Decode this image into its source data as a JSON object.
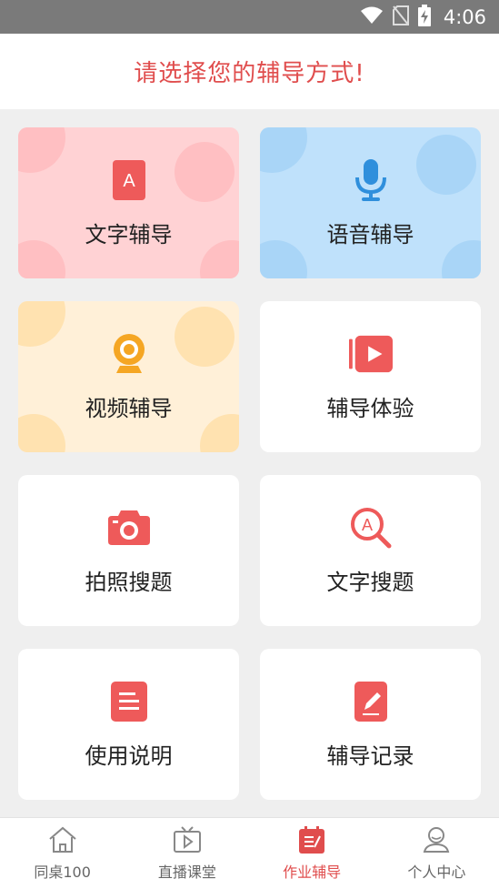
{
  "status_bar": {
    "time": "4:06"
  },
  "header": {
    "title": "请选择您的辅导方式!"
  },
  "cards": [
    {
      "label": "文字辅导",
      "icon": "text-a-icon"
    },
    {
      "label": "语音辅导",
      "icon": "microphone-icon"
    },
    {
      "label": "视频辅导",
      "icon": "webcam-icon"
    },
    {
      "label": "辅导体验",
      "icon": "video-play-icon"
    },
    {
      "label": "拍照搜题",
      "icon": "camera-icon"
    },
    {
      "label": "文字搜题",
      "icon": "search-a-icon"
    },
    {
      "label": "使用说明",
      "icon": "document-icon"
    },
    {
      "label": "辅导记录",
      "icon": "edit-note-icon"
    }
  ],
  "tabbar": {
    "items": [
      {
        "label": "同桌100",
        "icon": "home-icon"
      },
      {
        "label": "直播课堂",
        "icon": "tv-play-icon"
      },
      {
        "label": "作业辅导",
        "icon": "homework-icon",
        "active": true
      },
      {
        "label": "个人中心",
        "icon": "person-icon"
      }
    ]
  },
  "colors": {
    "accent": "#e04d4d",
    "icon_red": "#ee5a5a",
    "icon_blue": "#2f8fdc",
    "icon_orange": "#f5a623",
    "pink_card": "#ffd2d4",
    "blue_card": "#bfe1fb",
    "yellow_card": "#fff0d8"
  }
}
